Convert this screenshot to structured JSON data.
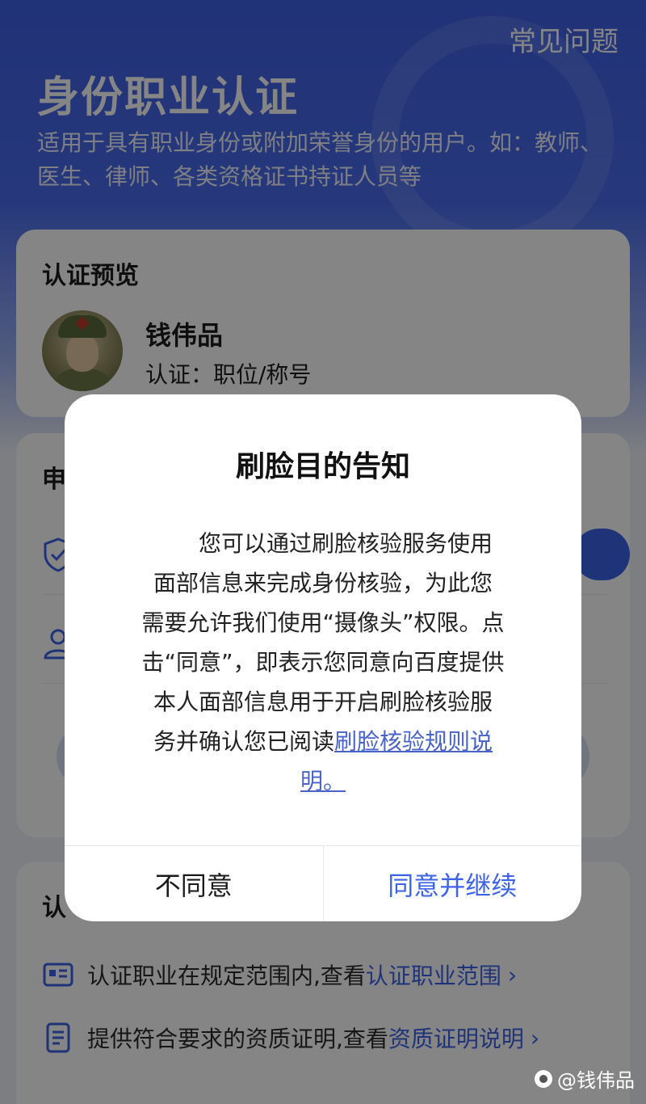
{
  "header": {
    "faq_label": "常见问题",
    "title": "身份职业认证",
    "description": "适用于具有职业身份或附加荣誉身份的用户。如：教师、医生、律师、各类资格证书持证人员等"
  },
  "preview": {
    "title": "认证预览",
    "user_name": "钱伟品",
    "cert_line": "认证：职位/称号"
  },
  "apply": {
    "title_partial": "申"
  },
  "requirements": {
    "title_partial": "认",
    "item1_text": "认证职业在规定范围内,查看",
    "item1_link": "认证职业范围",
    "item2_text": "提供符合要求的资质证明,查看",
    "item2_link": "资质证明说明",
    "arrow": "›"
  },
  "dialog": {
    "title": "刷脸目的告知",
    "line1": "您可以通过刷脸核验服务使用",
    "line2": "面部信息来完成身份核验，为此您",
    "line3": "需要允许我们使用“摄像头”权限。点",
    "line4": "击“同意”，即表示您同意向百度提供",
    "line5": "本人面部信息用于开启刷脸核验服",
    "line6_text": "务并确认您已阅读",
    "link_part1": "刷脸核验规则说",
    "link_part2": "明。",
    "disagree_label": "不同意",
    "agree_label": "同意并继续"
  },
  "watermark": {
    "text": "@钱伟品"
  },
  "colors": {
    "accent": "#3d63e8",
    "header_blue": "#3f60e6",
    "link": "#4a63c9"
  }
}
